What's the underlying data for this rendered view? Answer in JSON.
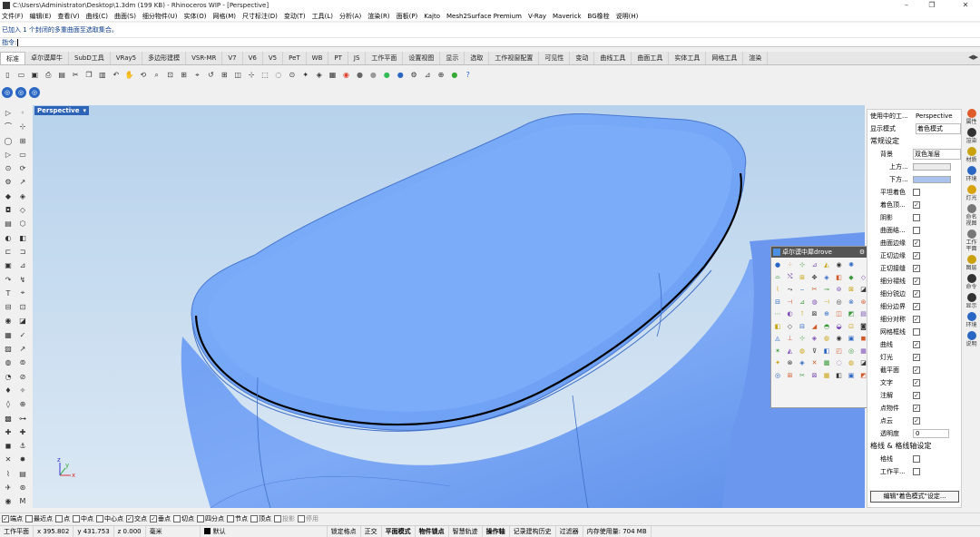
{
  "window": {
    "title": "C:\\Users\\Administrator\\Desktop\\1.3dm (199 KB) - Rhinoceros WIP - [Perspective]"
  },
  "menu": [
    "文件(F)",
    "编辑(E)",
    "查看(V)",
    "曲线(C)",
    "曲面(S)",
    "细分物件(U)",
    "实体(O)",
    "网格(M)",
    "尺寸标注(D)",
    "变动(T)",
    "工具(L)",
    "分析(A)",
    "渲染(R)",
    "面板(P)",
    "Kajto",
    "Mesh2Surface Premium",
    "V-Ray",
    "Maverick",
    "BG橡栓",
    "说明(H)"
  ],
  "command": {
    "history": "已加入 1 个封闭的多重曲面至选取集合。",
    "prompt": "指令:"
  },
  "tabs": [
    "标准",
    "卓尔谟犀牛",
    "SubD工具",
    "VRay5",
    "多边形建模",
    "VSR-MR",
    "V7",
    "V6",
    "V5",
    "PeT",
    "WB",
    "PT",
    "JS",
    "工作平面",
    "设置视图",
    "显示",
    "选取",
    "工作视窗配置",
    "可见性",
    "变动",
    "曲线工具",
    "曲面工具",
    "实体工具",
    "网格工具",
    "渲染"
  ],
  "viewport": {
    "name": "Perspective",
    "axis_x": "x",
    "axis_y": "y",
    "axis_z": "z"
  },
  "float_panel": {
    "title": "卓尔谟中犀drove"
  },
  "display_panel": {
    "current_label": "使用中的工...",
    "current_value": "Perspective",
    "mode_label": "显示模式",
    "mode_value": "着色模式",
    "section_general": "常规设定",
    "bg_label": "背景",
    "bg_value": "双色渐层",
    "top_label": "上方...",
    "bottom_label": "下方...",
    "bottom_color": "#a9c4ec",
    "top_color": "#ececec",
    "items": [
      {
        "label": "平坦着色",
        "checked": false
      },
      {
        "label": "着色顶...",
        "checked": true
      },
      {
        "label": "阴影",
        "checked": false
      },
      {
        "label": "曲面结...",
        "checked": false
      },
      {
        "label": "曲面边缘",
        "checked": true
      },
      {
        "label": "正切边缘",
        "checked": true
      },
      {
        "label": "正切接缝",
        "checked": true
      },
      {
        "label": "细分褶线",
        "checked": true
      },
      {
        "label": "细分锐边",
        "checked": true
      },
      {
        "label": "细分边界",
        "checked": true
      },
      {
        "label": "细分对称",
        "checked": true
      },
      {
        "label": "网格框线",
        "checked": false
      },
      {
        "label": "曲线",
        "checked": true
      },
      {
        "label": "灯光",
        "checked": true
      },
      {
        "label": "截平面",
        "checked": true
      },
      {
        "label": "文字",
        "checked": true
      },
      {
        "label": "注解",
        "checked": true
      },
      {
        "label": "点物件",
        "checked": true
      },
      {
        "label": "点云",
        "checked": true
      }
    ],
    "transparency_label": "透明度",
    "transparency_value": "0",
    "section_curves": "格线 & 格线轴设定",
    "grid_label": "格线",
    "workplane_label": "工作平...",
    "edit_button": "编辑\"着色模式\"设定..."
  },
  "side_tabs": [
    "属性",
    "渲染",
    "材质",
    "环境",
    "灯光",
    "命名视图",
    "工作平面",
    "图层",
    "命令",
    "显示",
    "环境",
    "说明"
  ],
  "osnaps": [
    {
      "label": "端点",
      "checked": true
    },
    {
      "label": "最近点",
      "checked": false
    },
    {
      "label": "点",
      "checked": false
    },
    {
      "label": "中点",
      "checked": false
    },
    {
      "label": "中心点",
      "checked": false
    },
    {
      "label": "交点",
      "checked": true
    },
    {
      "label": "垂点",
      "checked": true
    },
    {
      "label": "切点",
      "checked": false
    },
    {
      "label": "四分点",
      "checked": false
    },
    {
      "label": "节点",
      "checked": false
    },
    {
      "label": "顶点",
      "checked": false
    },
    {
      "label": "投影",
      "checked": false
    },
    {
      "label": "停用",
      "checked": false
    }
  ],
  "status": {
    "cplane": "工作平面",
    "x": "x 395.802",
    "y": "y 431.753",
    "z": "z 0.000",
    "unit": "毫米",
    "layer": "默认",
    "modes": [
      "锁定格点",
      "正交",
      "平面模式",
      "物件锁点",
      "智慧轨迹",
      "操作轴",
      "记录建构历史",
      "过滤器"
    ],
    "memory": "内存使用量: 704 MB"
  }
}
